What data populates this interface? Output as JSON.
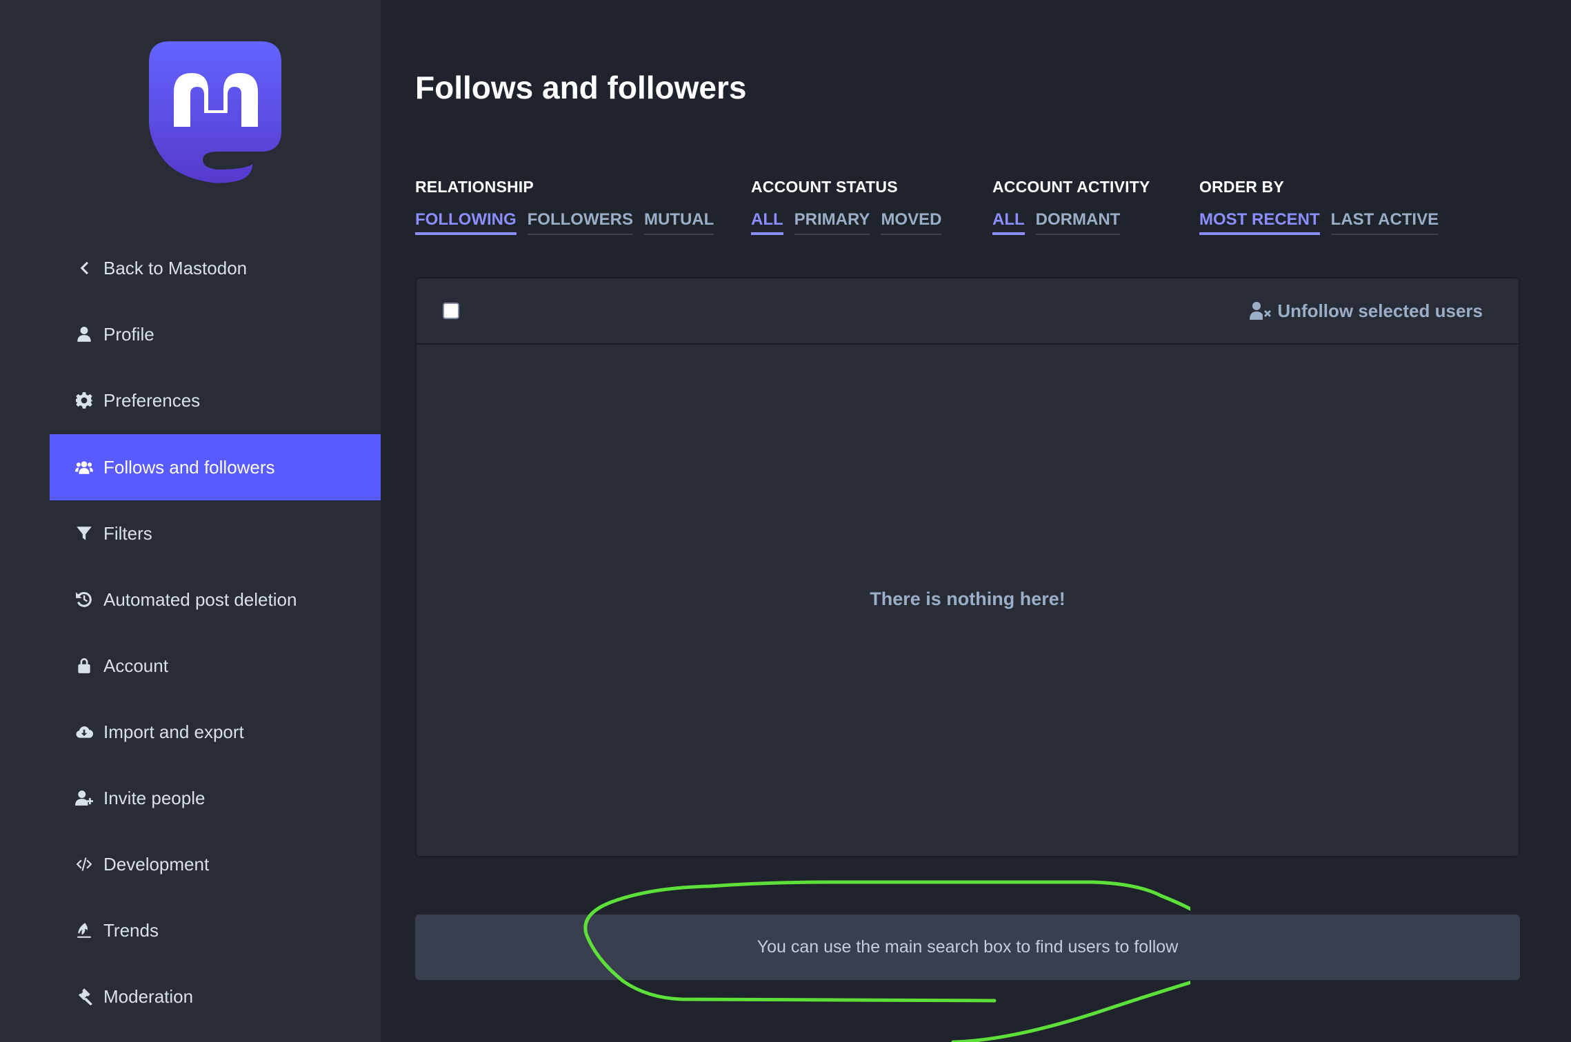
{
  "sidebar": {
    "items": [
      {
        "label": "Back to Mastodon",
        "icon": "chevron-left-icon"
      },
      {
        "label": "Profile",
        "icon": "user-icon"
      },
      {
        "label": "Preferences",
        "icon": "gear-icon"
      },
      {
        "label": "Follows and followers",
        "icon": "users-icon",
        "active": true
      },
      {
        "label": "Filters",
        "icon": "filter-icon"
      },
      {
        "label": "Automated post deletion",
        "icon": "history-icon"
      },
      {
        "label": "Account",
        "icon": "lock-icon"
      },
      {
        "label": "Import and export",
        "icon": "cloud-download-icon"
      },
      {
        "label": "Invite people",
        "icon": "user-plus-icon"
      },
      {
        "label": "Development",
        "icon": "code-icon"
      },
      {
        "label": "Trends",
        "icon": "fire-icon"
      },
      {
        "label": "Moderation",
        "icon": "gavel-icon"
      }
    ]
  },
  "main": {
    "title": "Follows and followers",
    "filters": [
      {
        "label": "RELATIONSHIP",
        "options": [
          "FOLLOWING",
          "FOLLOWERS",
          "MUTUAL"
        ],
        "selected": "FOLLOWING"
      },
      {
        "label": "ACCOUNT STATUS",
        "options": [
          "ALL",
          "PRIMARY",
          "MOVED"
        ],
        "selected": "ALL"
      },
      {
        "label": "ACCOUNT ACTIVITY",
        "options": [
          "ALL",
          "DORMANT"
        ],
        "selected": "ALL"
      },
      {
        "label": "ORDER BY",
        "options": [
          "MOST RECENT",
          "LAST ACTIVE"
        ],
        "selected": "MOST RECENT"
      }
    ],
    "table": {
      "unfollow_label": "Unfollow selected users",
      "empty_message": "There is nothing here!"
    },
    "hint": "You can use the main search box to find users to follow"
  },
  "colors": {
    "accent": "#595aff",
    "accent_text": "#8c8dff",
    "annotation": "#5ee03a"
  }
}
